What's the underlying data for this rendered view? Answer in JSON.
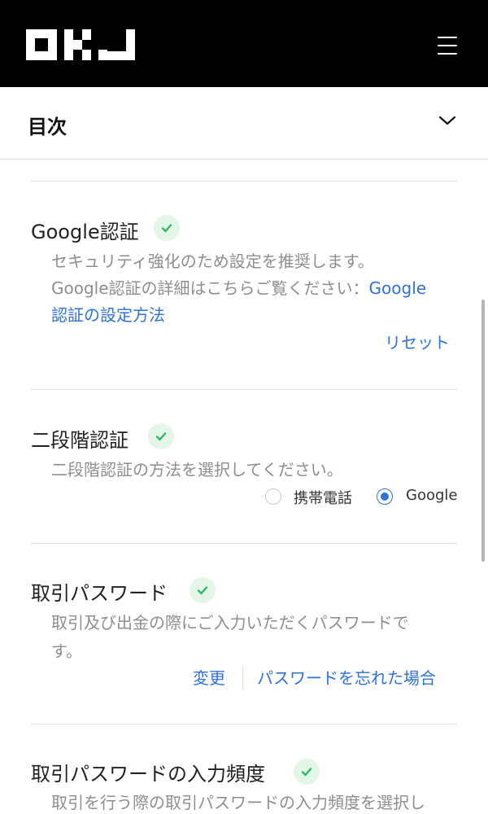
{
  "header": {
    "logo_text": "OKJ",
    "menu_icon": "hamburger-menu-icon"
  },
  "toc": {
    "title": "目次",
    "chevron_icon": "chevron-down-icon"
  },
  "sections": {
    "google_auth": {
      "title": "Google認証",
      "status": "enabled",
      "desc_line1": "セキュリティ強化のため設定を推奨します。",
      "desc_line2_prefix": "Google認証の詳細はこちらご覧ください：",
      "link_part1": "Google",
      "link_part2": "認証の設定方法",
      "action": "リセット"
    },
    "two_step": {
      "title": "二段階認証",
      "status": "enabled",
      "desc": "二段階認証の方法を選択してください。",
      "options": [
        "携帯電話",
        "Google"
      ],
      "selected": "Google"
    },
    "trade_password": {
      "title": "取引パスワード",
      "status": "enabled",
      "desc_line1": "取引及び出金の際にご入力いただくパスワードで",
      "desc_line2": "す。",
      "action_change": "変更",
      "action_forgot": "パスワードを忘れた場合"
    },
    "trade_password_freq": {
      "title": "取引パスワードの入力頻度",
      "status": "enabled",
      "desc": "取引を行う際の取引パスワードの入力頻度を選択し"
    }
  },
  "colors": {
    "accent": "#2f72d9",
    "check": "#2fb960",
    "check_bg": "#e4f6e8",
    "header_bg": "#000000"
  }
}
